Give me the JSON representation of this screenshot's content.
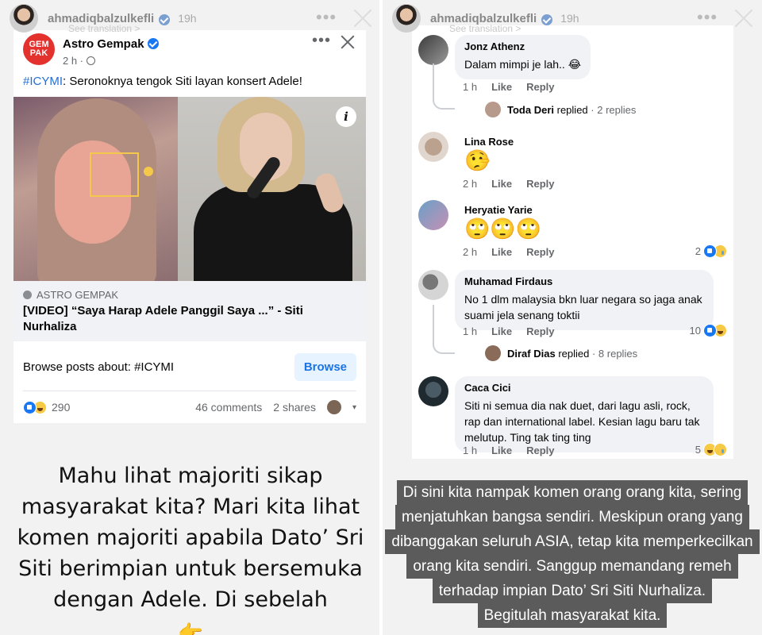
{
  "story": {
    "username": "ahmadiqbalzulkefli",
    "time": "19h",
    "more": "•••",
    "see_translation": "See translation >"
  },
  "post": {
    "page_name": "Astro Gempak",
    "logo_text": "GEM PAK",
    "time": "2 h ·",
    "hashtag": "#ICYMI",
    "text": ": Seronoknya tengok Siti layan konsert Adele!",
    "more": "•••",
    "info": "i",
    "link_source": "ASTRO GEMPAK",
    "link_title": "[VIDEO] “Saya Harap Adele Panggil Saya ...” - Siti Nurhaliza",
    "browse_text": "Browse posts about: #ICYMI",
    "browse_button": "Browse",
    "reaction_count": "290",
    "comments": "46 comments",
    "shares": "2 shares",
    "caret": "▾"
  },
  "left_caption": {
    "text": "Mahu lihat majoriti sikap masyarakat kita? Mari kita lihat komen majoriti apabila Dato’ Sri Siti berimpian untuk bersemuka dengan Adele. Di sebelah",
    "emoji": "👉"
  },
  "comments": [
    {
      "name": "Jonz Athenz",
      "text": "Dalam mimpi je lah.. 😂",
      "time": "1 h",
      "like": "Like",
      "reply": "Reply",
      "reaction_count": ""
    },
    {
      "name": "Lina Rose",
      "text": "🤥",
      "time": "2 h",
      "like": "Like",
      "reply": "Reply",
      "reaction_count": ""
    },
    {
      "name": "Heryatie Yarie",
      "text": "🙄🙄🙄",
      "time": "2 h",
      "like": "Like",
      "reply": "Reply",
      "reaction_count": "2"
    },
    {
      "name": "Muhamad Firdaus",
      "text": "No 1 dlm malaysia bkn luar negara so jaga anak suami jela senang toktii",
      "time": "1 h",
      "like": "Like",
      "reply": "Reply",
      "reaction_count": "10"
    },
    {
      "name": "Caca Cici",
      "text": "Siti ni semua dia nak duet, dari lagu asli, rock, rap dan international label. Kesian lagu baru tak melutup. Ting tak ting ting",
      "time": "1 h",
      "like": "Like",
      "reply": "Reply",
      "reaction_count": "5"
    }
  ],
  "replies": [
    {
      "name": "Toda Deri",
      "action": "replied",
      "count": "· 2 replies"
    },
    {
      "name": "Diraf Dias",
      "action": "replied",
      "count": "· 8 replies"
    }
  ],
  "right_caption": [
    "Di sini kita nampak komen orang orang kita, sering",
    "menjatuhkan bangsa sendiri. Meskipun orang yang",
    "dibanggakan seluruh ASIA, tetap kita memperkecilkan",
    "orang kita sendiri. Sanggup memandang remeh",
    "terhadap impian Dato’ Sri Siti Nurhaliza.",
    "Begitulah masyarakat kita."
  ],
  "colors": {
    "fb_blue": "#1877f2",
    "link_blue": "#216fdb",
    "gempak_red": "#e3312d"
  }
}
